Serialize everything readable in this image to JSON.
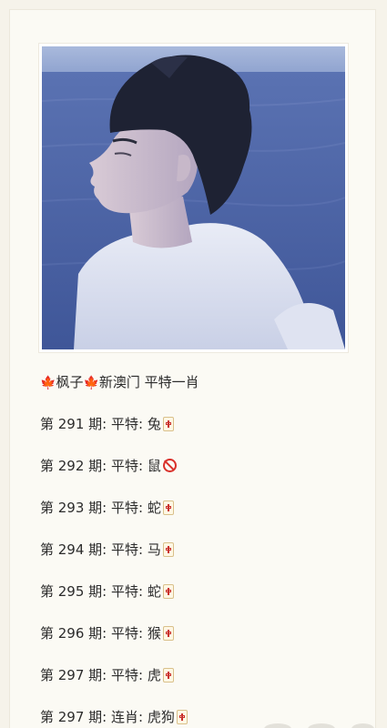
{
  "post": {
    "title_prefix": "枫子",
    "title_rest": "新澳门 平特一肖",
    "maple_icon": "maple-leaf-icon",
    "rows": [
      {
        "period": "第 291 期:",
        "type": "平特:",
        "value": "兔",
        "icon": "mahjong-tile-icon"
      },
      {
        "period": "第 292 期:",
        "type": "平特:",
        "value": "鼠",
        "icon": "prohibited-icon"
      },
      {
        "period": "第 293 期:",
        "type": "平特:",
        "value": "蛇",
        "icon": "mahjong-tile-icon"
      },
      {
        "period": "第 294 期:",
        "type": "平特:",
        "value": "马",
        "icon": "mahjong-tile-icon"
      },
      {
        "period": "第 295 期:",
        "type": "平特:",
        "value": "蛇",
        "icon": "mahjong-tile-icon"
      },
      {
        "period": "第 296 期:",
        "type": "平特:",
        "value": "猴",
        "icon": "mahjong-tile-icon"
      },
      {
        "period": "第 297 期:",
        "type": "平特:",
        "value": "虎",
        "icon": "mahjong-tile-icon"
      },
      {
        "period": "第 297 期:",
        "type": "连肖:",
        "value": "虎狗",
        "icon": "mahjong-tile-icon"
      }
    ]
  },
  "colors": {
    "page_bg": "#f6f3ea",
    "card_bg": "#fbfaf4",
    "text": "#2c2c2c",
    "maple": "#d9771c",
    "sea": "#4b66a8"
  }
}
